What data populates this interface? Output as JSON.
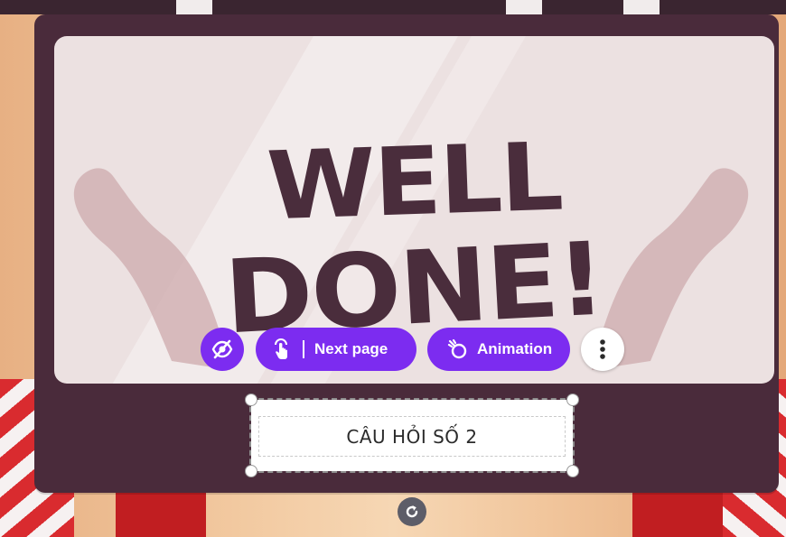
{
  "board": {
    "headline_line1": "WELL",
    "headline_line2": "DONE!"
  },
  "toolbar": {
    "hide_icon": "eye-slash-icon",
    "link_icon": "tap-link-icon",
    "link_label": "Next page",
    "animation_icon": "animation-icon",
    "animation_label": "Animation",
    "more_icon": "more-vertical-icon"
  },
  "textbox": {
    "text": "CÂU HỎI SỐ 2"
  },
  "rotate": {
    "icon": "rotate-icon"
  },
  "colors": {
    "accent": "#7c2cf0",
    "board": "#4a2b3b",
    "screen": "#ece1e1",
    "headline": "#4a2d3c"
  }
}
